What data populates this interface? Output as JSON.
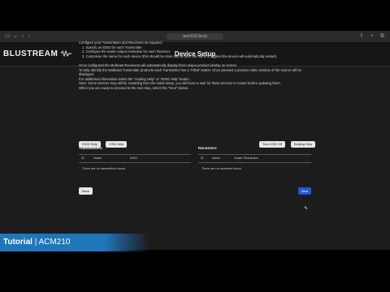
{
  "browser": {
    "url": "acm210.local"
  },
  "header": {
    "logo": "BLUSTREAM",
    "title": "Device Setup"
  },
  "instructions": [
    "Configure your Transmitters and Receivers as required:",
    "1.  Specify an EDID for each Transmitter.",
    "2.  Configure the scaler output resolution for each Receiver.",
    "3.  Customise the name for each device (this should be done last as after the name is applied the device will automatically restart).",
    "",
    "Once configured the Multicast Receivers will automatically display their unique product identity on screen",
    "To help identify the Multicast Transmitter products each Transmitter has a 'VIEW' button. Once pressed a preview video window of the source will be displayed.",
    "For additional information select the \"Scaling Help\" or \"EDID Help\" button.",
    "Note: Some devices may still be restarting from the initial setup, you will have to wait for these devices to restart before updating them.",
    "When you are ready to proceed to the next step, select the \"Next\" button."
  ],
  "buttons": {
    "edid_help": "EDID Help",
    "osd_help": "OSD Help",
    "turn_osd_off": "Turn OSD Off",
    "scaling_help": "Scaling Help",
    "back": "Back",
    "next": "Next"
  },
  "transmitters": {
    "title": "Transmitters",
    "columns": [
      "ID",
      "Name",
      "EDID"
    ],
    "empty": "There are no transmitters found"
  },
  "receivers": {
    "title": "Receivers",
    "columns": [
      "ID",
      "Name",
      "Scaler Resolution"
    ],
    "empty": "There are no receivers found"
  },
  "banner": {
    "tutorial": "Tutorial",
    "separator": "|",
    "product": "ACM210"
  }
}
